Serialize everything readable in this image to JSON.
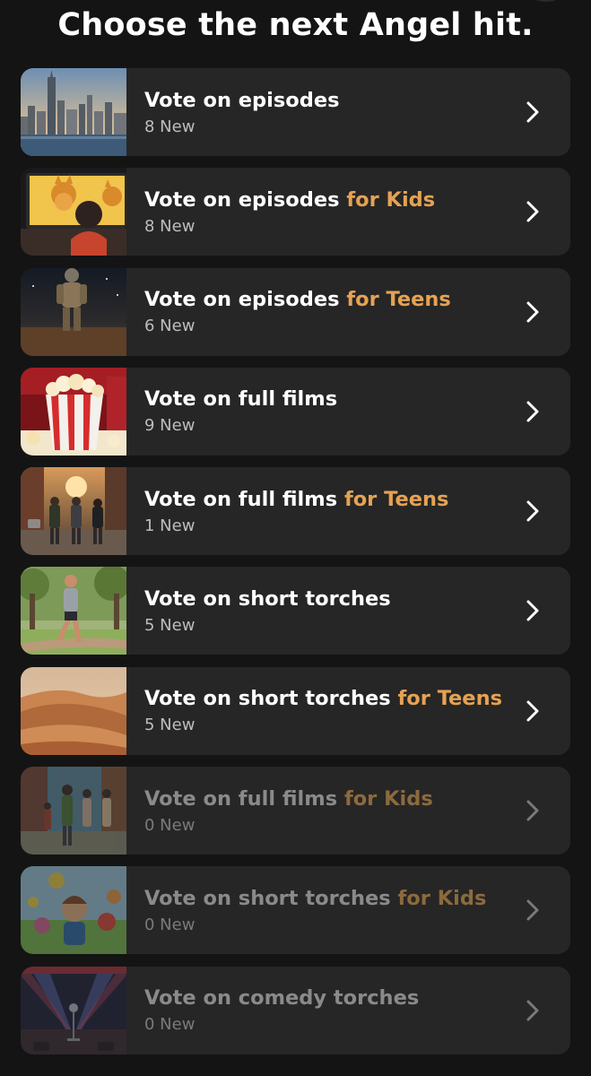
{
  "header": {
    "title": "Choose the next Angel hit."
  },
  "colors": {
    "accent": "#e5a253",
    "card_background": "#262626",
    "page_background": "#141414"
  },
  "items": [
    {
      "title": "Vote on episodes",
      "accent": "",
      "count": "8 New",
      "thumbnail": "city-skyline"
    },
    {
      "title": "Vote on episodes ",
      "accent": "for Kids",
      "count": "8 New",
      "thumbnail": "kids-watching-tv"
    },
    {
      "title": "Vote on episodes ",
      "accent": "for Teens",
      "count": "6 New",
      "thumbnail": "astronaut-landscape"
    },
    {
      "title": "Vote on full films",
      "accent": "",
      "count": "9 New",
      "thumbnail": "popcorn-bucket"
    },
    {
      "title": "Vote on full films ",
      "accent": "for Teens",
      "count": "1 New",
      "thumbnail": "teens-walking-street"
    },
    {
      "title": "Vote on short torches",
      "accent": "",
      "count": "5 New",
      "thumbnail": "runner-in-park"
    },
    {
      "title": "Vote on short torches ",
      "accent": "for Teens",
      "count": "5 New",
      "thumbnail": "desert-dunes"
    },
    {
      "title": "Vote on full films ",
      "accent": "for Kids",
      "count": "0 New",
      "thumbnail": "animated-family"
    },
    {
      "title": "Vote on short torches ",
      "accent": "for Kids",
      "count": "0 New",
      "thumbnail": "cartoon-characters"
    },
    {
      "title": "Vote on comedy torches",
      "accent": "",
      "count": "0 New",
      "thumbnail": "comedy-stage-microphone"
    }
  ]
}
